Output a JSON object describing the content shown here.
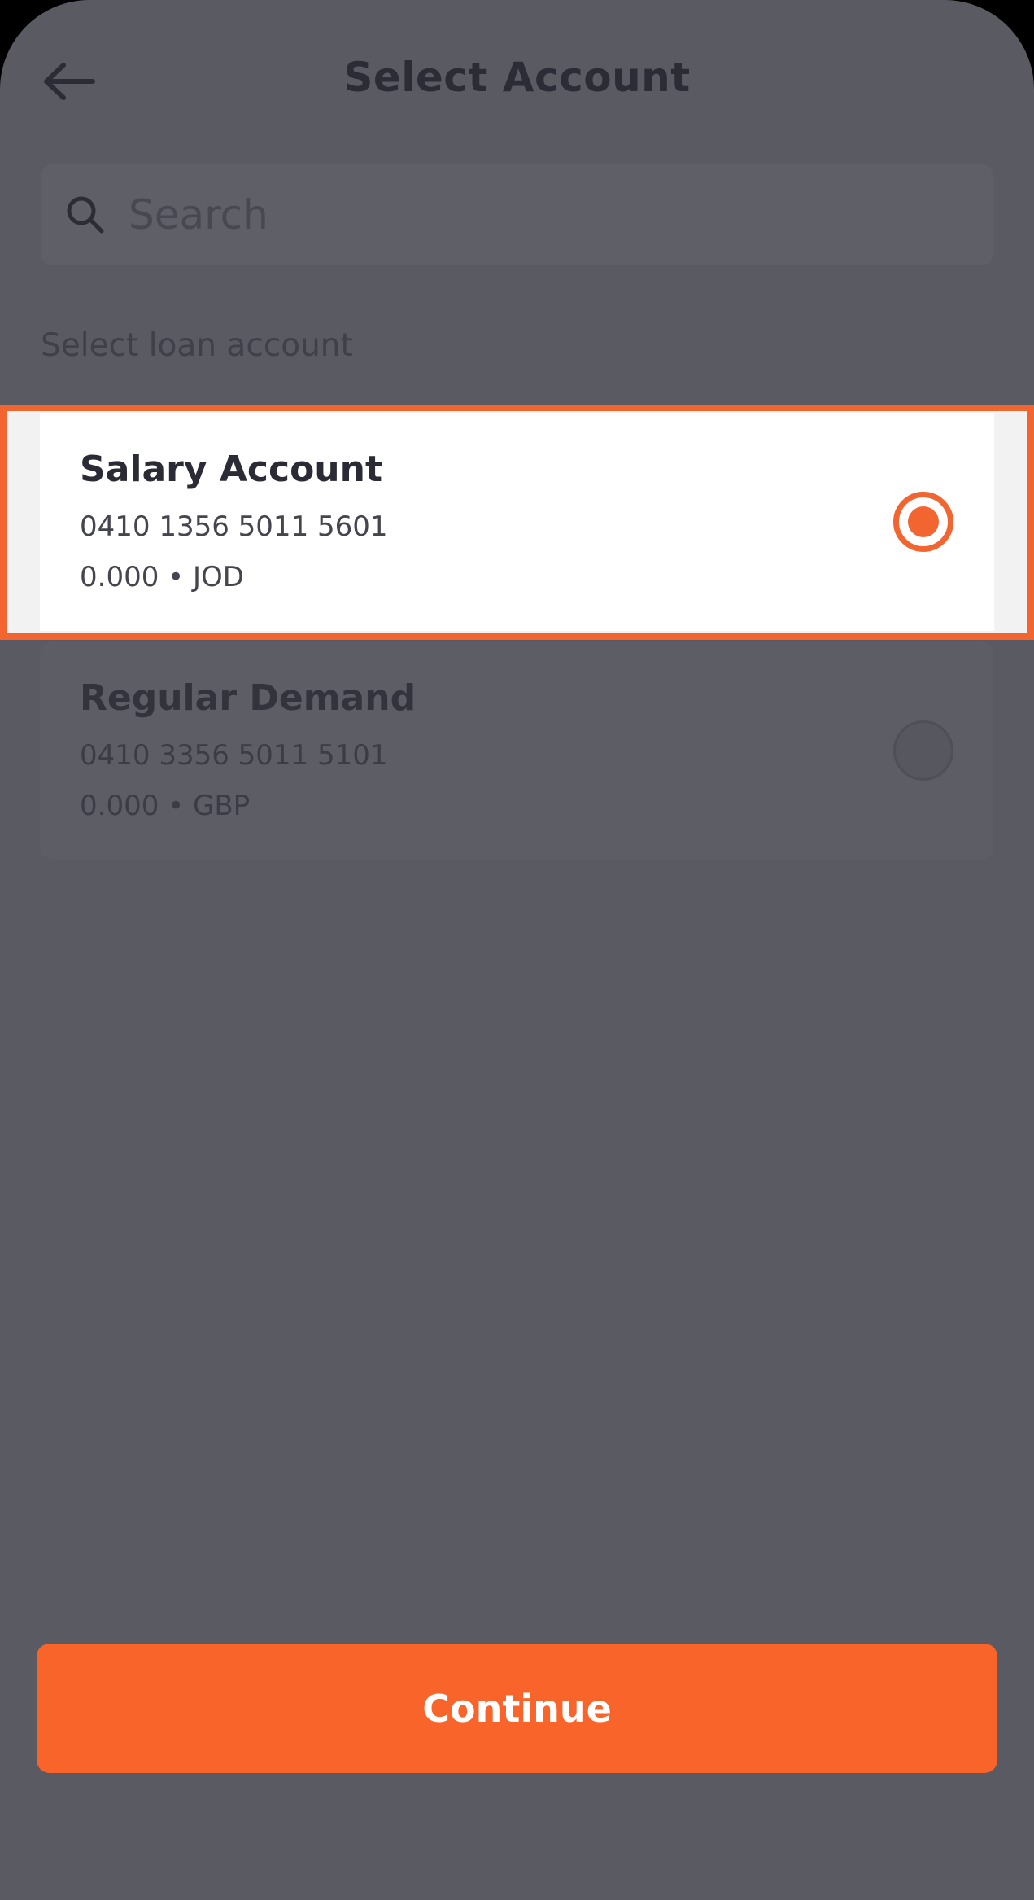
{
  "header": {
    "title": "Select Account",
    "back_icon": "arrow-left-icon"
  },
  "search": {
    "placeholder": "Search",
    "icon": "search-icon"
  },
  "section_label": "Select loan account",
  "accounts": [
    {
      "name": "Salary Account",
      "number": "0410 1356 5011 5601",
      "balance": "0.000 • JOD",
      "selected": true
    },
    {
      "name": "Regular Demand",
      "number": "0410 3356 5011 5101",
      "balance": "0.000 • GBP",
      "selected": false
    }
  ],
  "continue_label": "Continue",
  "colors": {
    "accent": "#f8642a",
    "highlight_border": "#f26530",
    "overlay": "#5a5a62"
  }
}
